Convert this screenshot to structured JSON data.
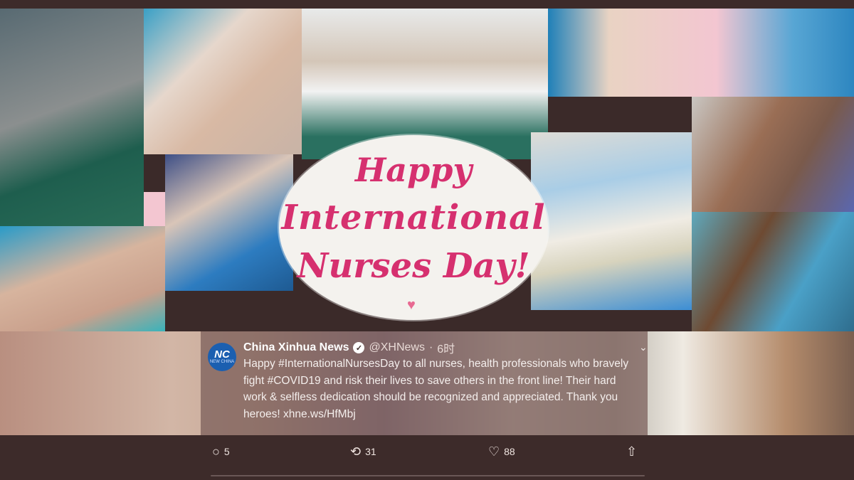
{
  "graphic": {
    "line1": "Happy",
    "line2": "International",
    "line3": "Nurses Day!",
    "heart_icon": "heart-icon",
    "text_color": "#d6306f"
  },
  "tweet": {
    "avatar_text": "NC",
    "avatar_subtext": "NEW CHINA",
    "display_name": "China Xinhua News",
    "handle": "@XHNews",
    "separator": "·",
    "time": "6时",
    "body_parts": [
      "Happy ",
      "#InternationalNursesDay",
      " to all nurses, health professionals who bravely fight ",
      "#COVID19",
      " and risk their lives to save others in the front line! Their hard work & selfless dedication should be recognized and appreciated. Thank you heroes! ",
      "xhne.ws/HfMbj"
    ],
    "verified_icon": "verified-badge-icon",
    "more_icon": "chevron-down-icon"
  },
  "actions": {
    "replies": "5",
    "retweets": "31",
    "likes": "88"
  }
}
